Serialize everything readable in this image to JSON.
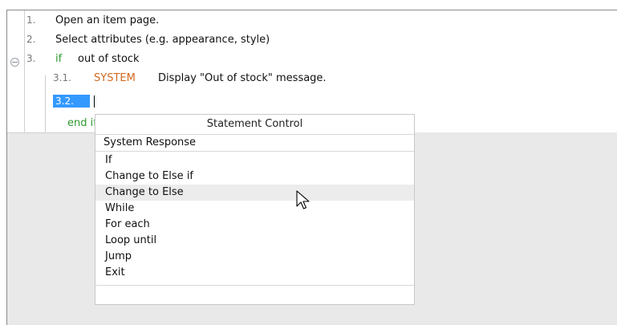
{
  "editor": {
    "steps": [
      {
        "num": "1.",
        "text": "Open an item page."
      },
      {
        "num": "2.",
        "text": "Select attributes (e.g. appearance, style)"
      },
      {
        "num": "3.",
        "keyword": "if",
        "text": "out of stock"
      },
      {
        "num": "3.1.",
        "keyword": "SYSTEM",
        "text": "Display \"Out of stock\" message."
      },
      {
        "num": "3.2.",
        "text": ""
      },
      {
        "keyword": "end if"
      }
    ]
  },
  "popup": {
    "title": "Statement Control",
    "top_item": "System Response",
    "items": [
      "If",
      "Change to Else if",
      "Change to Else",
      "While",
      "For each",
      "Loop until",
      "Jump",
      "Exit"
    ],
    "hovered": "Change to Else"
  },
  "colors": {
    "keyword_green": "#2e9a2e",
    "keyword_orange": "#d2691e",
    "selection": "#3399ff"
  },
  "icons": {
    "collapse": "circle-minus",
    "cursor": "arrow-pointer"
  }
}
